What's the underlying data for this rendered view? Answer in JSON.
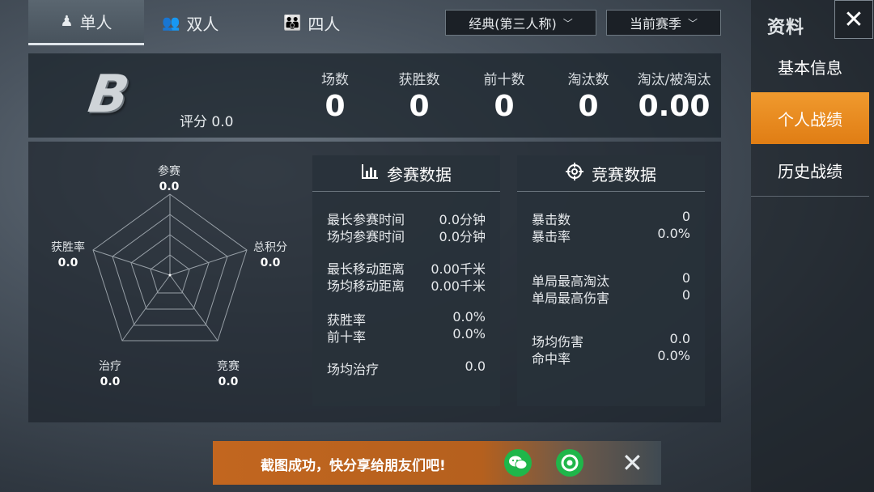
{
  "tabs": [
    {
      "label": "单人",
      "icon": "single-person-icon"
    },
    {
      "label": "双人",
      "icon": "duo-icon"
    },
    {
      "label": "四人",
      "icon": "squad-icon"
    }
  ],
  "dropdowns": {
    "mode": "经典(第三人称)",
    "season": "当前赛季"
  },
  "panel": {
    "title": "资料",
    "items": [
      "基本信息",
      "个人战绩",
      "历史战绩"
    ],
    "active_item": "个人战绩"
  },
  "summary": {
    "grade": "B",
    "rating_label": "评分 0.0",
    "stats": [
      {
        "label": "场数",
        "value": "0"
      },
      {
        "label": "获胜数",
        "value": "0"
      },
      {
        "label": "前十数",
        "value": "0"
      },
      {
        "label": "淘汰数",
        "value": "0"
      },
      {
        "label": "淘汰/被淘汰",
        "value": "0.00"
      }
    ]
  },
  "radar": {
    "axes": [
      {
        "label": "参赛",
        "value": "0.0"
      },
      {
        "label": "总积分",
        "value": "0.0"
      },
      {
        "label": "竞赛",
        "value": "0.0"
      },
      {
        "label": "治疗",
        "value": "0.0"
      },
      {
        "label": "获胜率",
        "value": "0.0"
      }
    ]
  },
  "participation": {
    "title": "参赛数据",
    "icon": "bar-chart-icon",
    "rows": [
      {
        "label": "最长参赛时间",
        "value": "0.0分钟"
      },
      {
        "label": "场均参赛时间",
        "value": "0.0分钟"
      },
      {
        "label": "最长移动距离",
        "value": "0.00千米"
      },
      {
        "label": "场均移动距离",
        "value": "0.00千米"
      },
      {
        "label": "获胜率",
        "value": "0.0%"
      },
      {
        "label": "前十率",
        "value": "0.0%"
      },
      {
        "label": "场均治疗",
        "value": "0.0"
      }
    ]
  },
  "competition": {
    "title": "竞赛数据",
    "icon": "crosshair-icon",
    "rows": [
      {
        "label": "暴击数",
        "value": "0"
      },
      {
        "label": "暴击率",
        "value": "0.0%"
      },
      {
        "label": "单局最高淘汰",
        "value": "0"
      },
      {
        "label": "单局最高伤害",
        "value": "0"
      },
      {
        "label": "场均伤害",
        "value": "0.0"
      },
      {
        "label": "命中率",
        "value": "0.0%"
      }
    ]
  },
  "toast": {
    "message": "截图成功，快分享给朋友们吧!"
  },
  "colors": {
    "accent": "#e8891c",
    "share_green": "#1fb64a"
  }
}
